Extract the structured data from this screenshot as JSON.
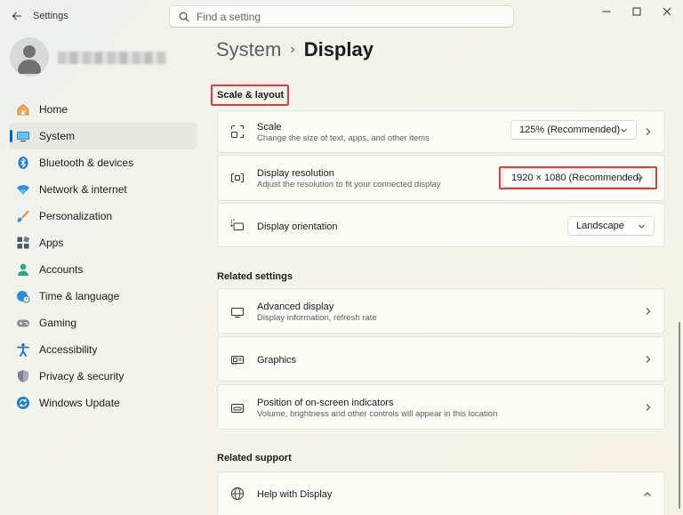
{
  "window": {
    "app_title": "Settings"
  },
  "search": {
    "placeholder": "Find a setting"
  },
  "sidebar": {
    "items": [
      {
        "label": "Home",
        "icon": "home-icon"
      },
      {
        "label": "System",
        "icon": "monitor-icon",
        "selected": true
      },
      {
        "label": "Bluetooth & devices",
        "icon": "bluetooth-icon"
      },
      {
        "label": "Network & internet",
        "icon": "wifi-icon"
      },
      {
        "label": "Personalization",
        "icon": "brush-icon"
      },
      {
        "label": "Apps",
        "icon": "apps-icon"
      },
      {
        "label": "Accounts",
        "icon": "person-icon"
      },
      {
        "label": "Time & language",
        "icon": "globe-clock-icon"
      },
      {
        "label": "Gaming",
        "icon": "gamepad-icon"
      },
      {
        "label": "Accessibility",
        "icon": "accessibility-icon"
      },
      {
        "label": "Privacy & security",
        "icon": "shield-icon"
      },
      {
        "label": "Windows Update",
        "icon": "update-icon"
      }
    ]
  },
  "breadcrumb": {
    "parent": "System",
    "separator": "›",
    "current": "Display"
  },
  "scale_layout": {
    "heading": "Scale & layout",
    "scale": {
      "title": "Scale",
      "subtitle": "Change the size of text, apps, and other items",
      "value": "125% (Recommended)"
    },
    "resolution": {
      "title": "Display resolution",
      "subtitle": "Adjust the resolution to fit your connected display",
      "value": "1920 × 1080 (Recommended)"
    },
    "orientation": {
      "title": "Display orientation",
      "value": "Landscape"
    }
  },
  "related_settings": {
    "heading": "Related settings",
    "advanced": {
      "title": "Advanced display",
      "subtitle": "Display information, refresh rate"
    },
    "graphics": {
      "title": "Graphics"
    },
    "indicators": {
      "title": "Position of on-screen indicators",
      "subtitle": "Volume, brightness and other controls will appear in this location"
    }
  },
  "related_support": {
    "heading": "Related support",
    "help": {
      "title": "Help with Display"
    }
  },
  "colors": {
    "accent": "#0067c0",
    "highlight": "#e03c3c"
  }
}
